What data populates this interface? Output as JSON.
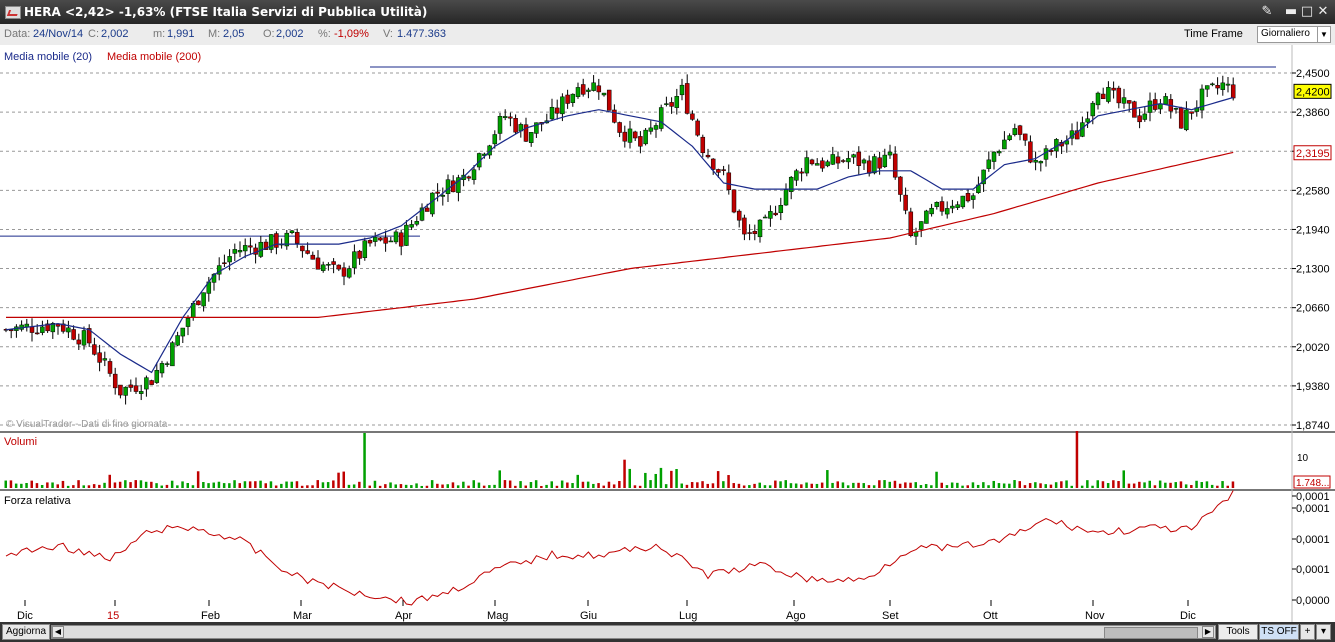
{
  "window": {
    "title": "HERA <2,42> -1,63%  (FTSE Italia Servizi di Pubblica Utilità)"
  },
  "infobar": {
    "data_label": "Data:",
    "data_value": "24/Nov/14",
    "c_label": "C:",
    "c_value": "2,002",
    "m_label": "m:",
    "m_value": "1,991",
    "M_label": "M:",
    "M_value": "2,05",
    "o_label": "O:",
    "o_value": "2,002",
    "pct_label": "%:",
    "pct_value": "-1,09%",
    "v_label": "V:",
    "v_value": "1.477.363",
    "timeframe_label": "Time Frame",
    "timeframe_value": "Giornaliero"
  },
  "legend": {
    "ma20": "Media mobile (20)",
    "ma200": "Media mobile (200)"
  },
  "colors": {
    "up": "#00a000",
    "down": "#c00000",
    "ma20": "#1a2a8a",
    "ma200": "#c00000",
    "price_badge": "#ffff00"
  },
  "watermark": "© VisualTrader - Dati di fine giornata",
  "price_axis": [
    "2,4500",
    "2,3860",
    "2,3195",
    "2,2580",
    "2,1940",
    "2,1300",
    "2,0660",
    "2,0020",
    "1,9380",
    "1,8740"
  ],
  "last_price": "2,4200",
  "ma200_value": "2,3195",
  "volume_panel": {
    "title": "Volumi",
    "axis_label": "10",
    "last_value": "1.748..."
  },
  "rs_panel": {
    "title": "Forza relativa",
    "axis": [
      "0,0001",
      "0,0001",
      "0,0001",
      "0,0001",
      "0,0000"
    ]
  },
  "x_axis": [
    "Dic",
    "15",
    "Feb",
    "Mar",
    "Apr",
    "Mag",
    "Giu",
    "Lug",
    "Ago",
    "Set",
    "Ott",
    "Nov",
    "Dic"
  ],
  "statusbar": {
    "update_button": "Aggiorna",
    "tools_button": "Tools",
    "ts_button": "TS OFF",
    "plus_button": "+"
  },
  "chart_data": {
    "type": "candlestick",
    "ylim": [
      1.874,
      2.47
    ],
    "x_labels": [
      "Dic",
      "15",
      "Feb",
      "Mar",
      "Apr",
      "Mag",
      "Giu",
      "Lug",
      "Ago",
      "Set",
      "Ott",
      "Nov",
      "Dic"
    ],
    "close_anchors": [
      [
        0,
        2.03
      ],
      [
        10,
        2.04
      ],
      [
        16,
        2.01
      ],
      [
        22,
        1.93
      ],
      [
        28,
        1.95
      ],
      [
        32,
        2.0
      ],
      [
        38,
        2.1
      ],
      [
        44,
        2.16
      ],
      [
        50,
        2.17
      ],
      [
        55,
        2.18
      ],
      [
        60,
        2.14
      ],
      [
        64,
        2.12
      ],
      [
        70,
        2.17
      ],
      [
        76,
        2.18
      ],
      [
        82,
        2.25
      ],
      [
        88,
        2.28
      ],
      [
        92,
        2.33
      ],
      [
        96,
        2.38
      ],
      [
        100,
        2.35
      ],
      [
        105,
        2.38
      ],
      [
        110,
        2.43
      ],
      [
        114,
        2.43
      ],
      [
        118,
        2.36
      ],
      [
        122,
        2.33
      ],
      [
        126,
        2.38
      ],
      [
        130,
        2.42
      ],
      [
        134,
        2.33
      ],
      [
        138,
        2.28
      ],
      [
        142,
        2.18
      ],
      [
        146,
        2.2
      ],
      [
        150,
        2.26
      ],
      [
        154,
        2.31
      ],
      [
        158,
        2.3
      ],
      [
        162,
        2.31
      ],
      [
        166,
        2.3
      ],
      [
        170,
        2.31
      ],
      [
        174,
        2.18
      ],
      [
        178,
        2.22
      ],
      [
        182,
        2.24
      ],
      [
        186,
        2.25
      ],
      [
        190,
        2.32
      ],
      [
        194,
        2.36
      ],
      [
        198,
        2.3
      ],
      [
        202,
        2.33
      ],
      [
        206,
        2.35
      ],
      [
        210,
        2.43
      ],
      [
        214,
        2.4
      ],
      [
        218,
        2.38
      ],
      [
        222,
        2.41
      ],
      [
        226,
        2.37
      ],
      [
        230,
        2.41
      ],
      [
        234,
        2.43
      ],
      [
        236,
        2.42
      ]
    ],
    "ma20_anchors": [
      [
        0,
        2.03
      ],
      [
        10,
        2.04
      ],
      [
        16,
        2.03
      ],
      [
        22,
        1.99
      ],
      [
        28,
        1.96
      ],
      [
        34,
        2.05
      ],
      [
        40,
        2.12
      ],
      [
        46,
        2.15
      ],
      [
        52,
        2.17
      ],
      [
        58,
        2.17
      ],
      [
        64,
        2.17
      ],
      [
        70,
        2.18
      ],
      [
        76,
        2.2
      ],
      [
        82,
        2.24
      ],
      [
        88,
        2.28
      ],
      [
        94,
        2.33
      ],
      [
        100,
        2.36
      ],
      [
        108,
        2.38
      ],
      [
        114,
        2.39
      ],
      [
        120,
        2.38
      ],
      [
        126,
        2.37
      ],
      [
        132,
        2.33
      ],
      [
        138,
        2.27
      ],
      [
        144,
        2.26
      ],
      [
        150,
        2.26
      ],
      [
        156,
        2.26
      ],
      [
        162,
        2.28
      ],
      [
        168,
        2.29
      ],
      [
        174,
        2.29
      ],
      [
        180,
        2.26
      ],
      [
        186,
        2.26
      ],
      [
        192,
        2.3
      ],
      [
        198,
        2.31
      ],
      [
        204,
        2.34
      ],
      [
        210,
        2.38
      ],
      [
        216,
        2.39
      ],
      [
        222,
        2.4
      ],
      [
        228,
        2.39
      ],
      [
        236,
        2.41
      ]
    ],
    "ma200_anchors": [
      [
        0,
        2.05
      ],
      [
        30,
        2.05
      ],
      [
        60,
        2.05
      ],
      [
        90,
        2.08
      ],
      [
        120,
        2.13
      ],
      [
        150,
        2.16
      ],
      [
        170,
        2.18
      ],
      [
        190,
        2.22
      ],
      [
        210,
        2.27
      ],
      [
        236,
        2.32
      ]
    ],
    "resistance_levels": [
      2.45,
      2.183
    ]
  }
}
